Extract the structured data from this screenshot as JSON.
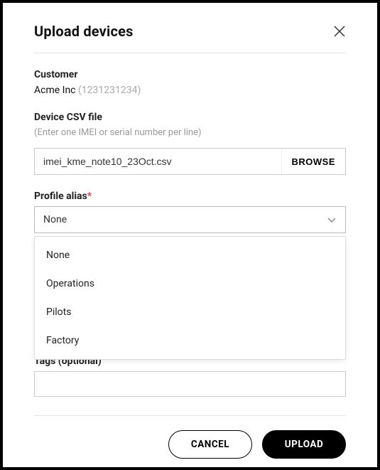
{
  "header": {
    "title": "Upload devices"
  },
  "customer": {
    "label": "Customer",
    "name": "Acme Inc",
    "id": "(1231231234)"
  },
  "csv": {
    "label": "Device CSV file",
    "hint": "(Enter one IMEI or serial number per line)",
    "filename": "imei_kme_note10_23Oct.csv",
    "browse": "BROWSE"
  },
  "profile": {
    "label": "Profile alias",
    "required_mark": "*",
    "selected": "None",
    "options": [
      "None",
      "Operations",
      "Pilots",
      "Factory"
    ]
  },
  "tags": {
    "label": "Tags (optional)",
    "value": ""
  },
  "footer": {
    "cancel": "CANCEL",
    "upload": "UPLOAD"
  }
}
